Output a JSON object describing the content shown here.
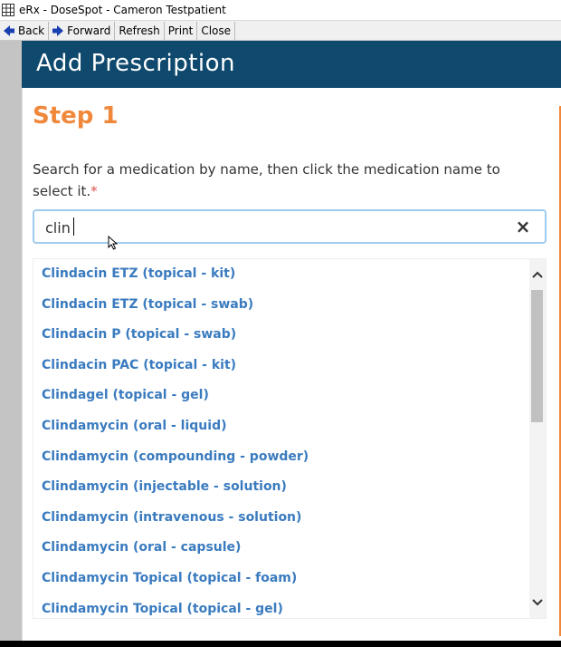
{
  "window": {
    "title": "eRx - DoseSpot - Cameron Testpatient"
  },
  "toolbar": {
    "back_label": "Back",
    "forward_label": "Forward",
    "refresh_label": "Refresh",
    "print_label": "Print",
    "close_label": "Close"
  },
  "dialog": {
    "title": "Add Prescription",
    "step_label": "Step 1",
    "instruction": "Search for a medication by name, then click the medication name to select it.",
    "required_marker": "*"
  },
  "search": {
    "value": "clin",
    "clear_icon": "close-icon"
  },
  "results": [
    "Clindacin ETZ (topical - kit)",
    "Clindacin ETZ (topical - swab)",
    "Clindacin P (topical - swab)",
    "Clindacin PAC (topical - kit)",
    "Clindagel (topical - gel)",
    "Clindamycin (oral - liquid)",
    "Clindamycin (compounding - powder)",
    "Clindamycin (injectable - solution)",
    "Clindamycin (intravenous - solution)",
    "Clindamycin (oral - capsule)",
    "Clindamycin Topical (topical - foam)",
    "Clindamycin Topical (topical - gel)"
  ],
  "colors": {
    "header_bg": "#0f4a6e",
    "step_accent": "#f0883b",
    "link": "#3a7bbf",
    "required": "#d9534f",
    "focus_border": "#9ecbf0"
  }
}
